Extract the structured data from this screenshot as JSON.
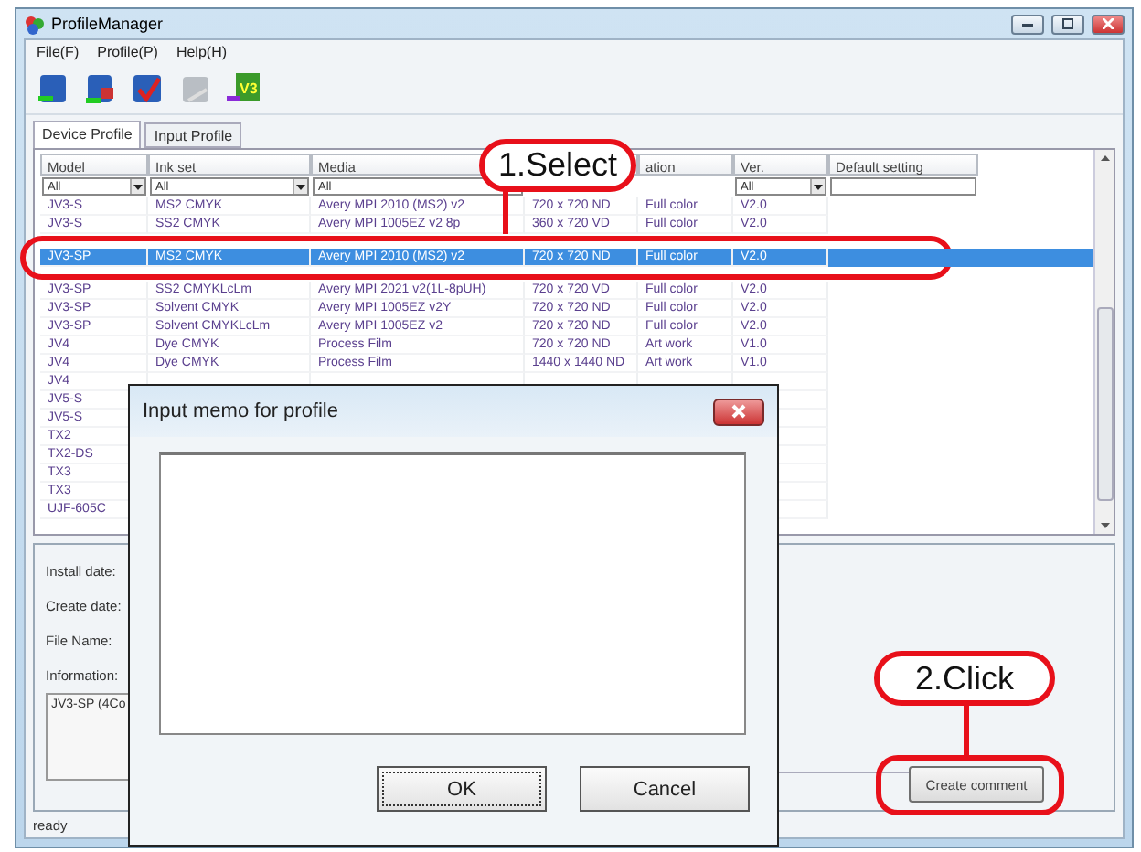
{
  "window": {
    "title": "ProfileManager"
  },
  "menu": [
    "File(F)",
    "Profile(P)",
    "Help(H)"
  ],
  "toolbar": [
    {
      "kind": "import",
      "disabled": false
    },
    {
      "kind": "export",
      "disabled": false
    },
    {
      "kind": "edit",
      "disabled": false
    },
    {
      "kind": "delete",
      "disabled": true
    },
    {
      "kind": "version",
      "disabled": false,
      "label": "V3"
    }
  ],
  "tabs": [
    {
      "label": "Device Profile",
      "selected": true
    },
    {
      "label": "Input Profile",
      "selected": false
    }
  ],
  "table": {
    "columns": [
      {
        "label": "Model",
        "filter": "All",
        "dropdown": true
      },
      {
        "label": "Ink set",
        "filter": "All",
        "dropdown": true
      },
      {
        "label": "Media",
        "filter": "All",
        "dropdown": false
      },
      {},
      {
        "label": "ation"
      },
      {
        "label": "Ver.",
        "filter": "All",
        "dropdown": true
      },
      {
        "label": "Default setting",
        "field": true
      }
    ],
    "rows": [
      {
        "cells": [
          "JV3-S",
          "MS2 CMYK",
          "Avery MPI 2010 (MS2) v2",
          "720 x 720 ND",
          "Full color",
          "V2.0"
        ],
        "selected": false
      },
      {
        "cells": [
          "JV3-S",
          "SS2 CMYK",
          "Avery MPI 1005EZ v2 8p",
          "360 x 720 VD",
          "Full color",
          "V2.0"
        ],
        "selected": false
      },
      {
        "cells": [
          "JV3-SP",
          "MS2 CMYK",
          "Avery MPI 2010 (MS2) v2",
          "720 x 720 ND",
          "Full color",
          "V2.0"
        ],
        "selected": true
      },
      {
        "cells": [
          "JV3-SP",
          "SS2 CMYKLcLm",
          "Avery MPI 2021 v2(1L-8pUH)",
          "720 x 720 VD",
          "Full color",
          "V2.0"
        ],
        "selected": false
      },
      {
        "cells": [
          "JV3-SP",
          "Solvent CMYK",
          "Avery MPI 1005EZ v2Y",
          "720 x 720 ND",
          "Full color",
          "V2.0"
        ],
        "selected": false
      },
      {
        "cells": [
          "JV3-SP",
          "Solvent CMYKLcLm",
          "Avery MPI 1005EZ v2",
          "720 x 720 ND",
          "Full color",
          "V2.0"
        ],
        "selected": false
      },
      {
        "cells": [
          "JV4",
          "Dye CMYK",
          "Process Film",
          "720 x 720 ND",
          "Art work",
          "V1.0"
        ],
        "selected": false
      },
      {
        "cells": [
          "JV4",
          "Dye CMYK",
          "Process Film",
          "1440 x 1440 ND",
          "Art work",
          "V1.0"
        ],
        "selected": false
      },
      {
        "cells": [
          "JV4"
        ],
        "selected": false
      },
      {
        "cells": [
          "JV5-S"
        ],
        "selected": false
      },
      {
        "cells": [
          "JV5-S"
        ],
        "selected": false
      },
      {
        "cells": [
          "TX2"
        ],
        "selected": false
      },
      {
        "cells": [
          "TX2-DS"
        ],
        "selected": false
      },
      {
        "cells": [
          "TX3"
        ],
        "selected": false
      },
      {
        "cells": [
          "TX3"
        ],
        "selected": false
      },
      {
        "cells": [
          "UJF-605C"
        ],
        "selected": false
      }
    ]
  },
  "details": {
    "labels": [
      "Install date:",
      "Create date:",
      "File Name:",
      "Information:"
    ],
    "information": "JV3-SP (4Co",
    "button": "Create comment"
  },
  "status": "ready",
  "dialog": {
    "title": "Input memo for profile",
    "ok": "OK",
    "cancel": "Cancel"
  },
  "callouts": [
    {
      "text": "1.Select"
    },
    {
      "text": "2.Click"
    }
  ]
}
